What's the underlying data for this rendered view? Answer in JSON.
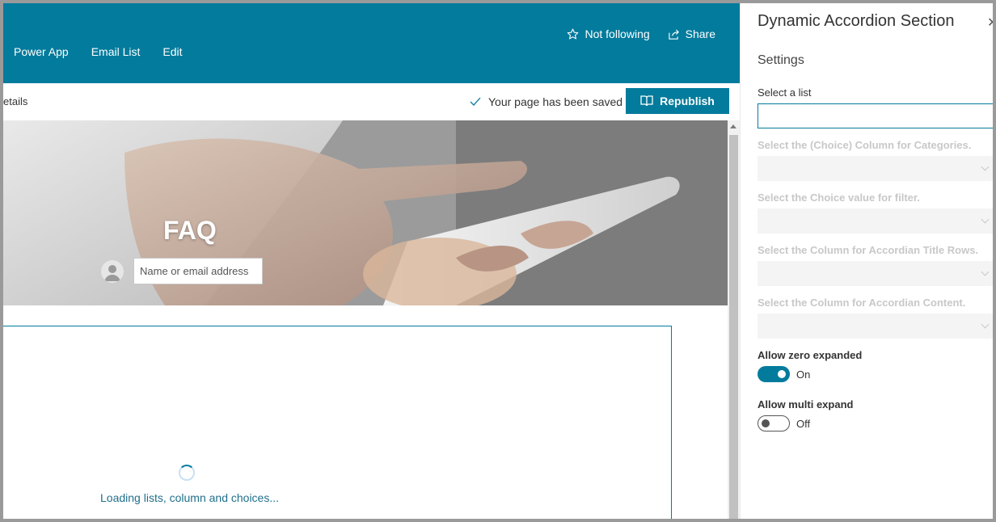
{
  "header": {
    "nav": [
      "Power App",
      "Email List",
      "Edit"
    ],
    "follow_label": "Not following",
    "share_label": "Share",
    "icons": {
      "follow": "star-icon",
      "share": "share-icon"
    }
  },
  "command_bar": {
    "details_crumb": "etails",
    "save_status": "Your page has been saved",
    "republish_label": "Republish"
  },
  "hero": {
    "title": "FAQ",
    "author_placeholder": "Name or email address"
  },
  "webpart": {
    "loading_text": "Loading lists, column and choices..."
  },
  "property_pane": {
    "title": "Dynamic Accordion Section",
    "group": "Settings",
    "select_list_label": "Select a list",
    "category_column_label": "Select the (Choice) Column for Categories.",
    "choice_value_label": "Select the Choice value for filter.",
    "title_column_label": "Select the Column for Accordian Title Rows.",
    "content_column_label": "Select the Column for Accordian Content.",
    "allow_zero_label": "Allow zero expanded",
    "allow_zero_state": "On",
    "allow_multi_label": "Allow multi expand",
    "allow_multi_state": "Off"
  },
  "colors": {
    "brand": "#037b9c"
  }
}
